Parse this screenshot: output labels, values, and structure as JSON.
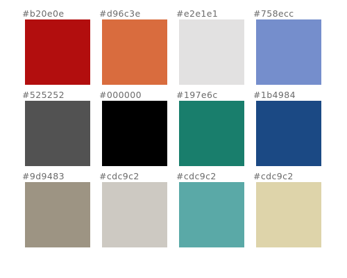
{
  "swatches": [
    {
      "label": "#b20e0e",
      "color": "#b20e0e"
    },
    {
      "label": "#d96c3e",
      "color": "#d96c3e"
    },
    {
      "label": "#e2e1e1",
      "color": "#e2e1e1"
    },
    {
      "label": "#758ecc",
      "color": "#758ecc"
    },
    {
      "label": "#525252",
      "color": "#525252"
    },
    {
      "label": "#000000",
      "color": "#000000"
    },
    {
      "label": "#197e6c",
      "color": "#197e6c"
    },
    {
      "label": "#1b4984",
      "color": "#1b4984"
    },
    {
      "label": "#9d9483",
      "color": "#9d9483"
    },
    {
      "label": "#cdc9c2",
      "color": "#cdc9c2"
    },
    {
      "label": "#cdc9c2",
      "color": "#5aa9a7"
    },
    {
      "label": "#cdc9c2",
      "color": "#ded4aa"
    }
  ]
}
